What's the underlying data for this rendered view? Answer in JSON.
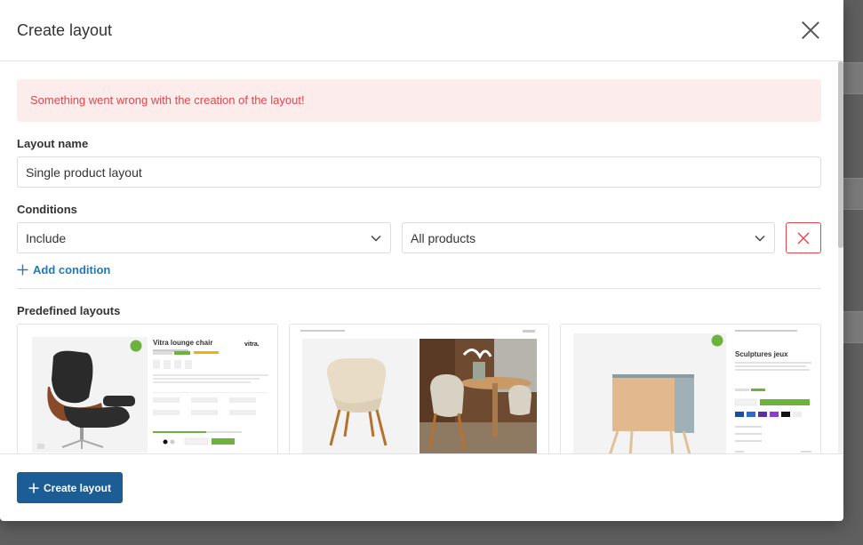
{
  "modal": {
    "title": "Create layout",
    "close_icon": "close-icon"
  },
  "alert": {
    "message": "Something went wrong with the creation of the layout!",
    "color": "#e0464c",
    "background": "#fdecec"
  },
  "layout_name": {
    "label": "Layout name",
    "value": "Single product layout"
  },
  "conditions": {
    "label": "Conditions",
    "rule_select": "Include",
    "target_select": "All products",
    "remove_icon": "x-icon",
    "add_label": "Add condition"
  },
  "predefined": {
    "label": "Predefined layouts",
    "cards": [
      {
        "product_title": "Vitra lounge chair",
        "brand": "vitra."
      },
      {
        "product_title": ""
      },
      {
        "product_title": "Sculptures jeux"
      }
    ]
  },
  "footer": {
    "create_label": "Create layout",
    "accent": "#1b5d94"
  }
}
